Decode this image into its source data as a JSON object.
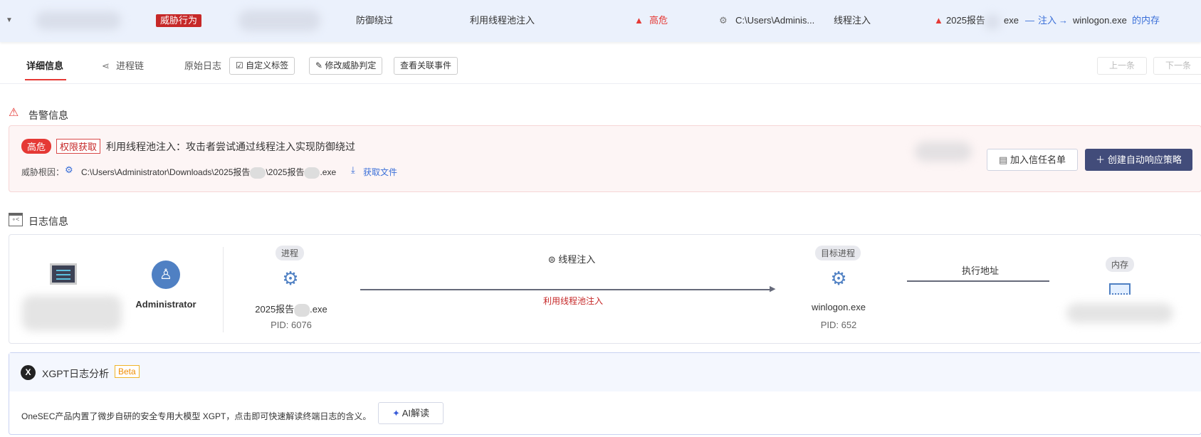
{
  "top_row": {
    "category_badge": "威胁行为",
    "tactic": "防御绕过",
    "technique": "利用线程池注入",
    "severity": "高危",
    "path": "C:\\Users\\Adminis...",
    "behavior": "线程注入",
    "chain_source": "2025报告",
    "chain_source_ext": "exe",
    "chain_action": "注入",
    "chain_target": "winlogon.exe",
    "chain_suffix": "的内存"
  },
  "tabs": {
    "detail": "详细信息",
    "process_chain": "进程链",
    "raw_log": "原始日志",
    "custom_tag": "自定义标签",
    "modify_verdict": "修改威胁判定",
    "related_events": "查看关联事件",
    "prev": "上一条",
    "next": "下一条"
  },
  "alert": {
    "title": "告警信息",
    "severity": "高危",
    "tag": "权限获取",
    "description": "利用线程池注入：攻击者尝试通过线程注入实现防御绕过",
    "root_label": "威胁根因：",
    "root_path_a": "C:\\Users\\Administrator\\Downloads\\2025报告",
    "root_path_b": "\\2025报告",
    "root_path_c": ".exe",
    "get_file": "获取文件",
    "trust_button": "加入信任名单",
    "create_policy_button": "创建自动响应策略"
  },
  "log": {
    "title": "日志信息",
    "user": "Administrator",
    "process_label": "进程",
    "process_name_a": "2025报告",
    "process_name_b": ".exe",
    "process_pid": "PID: 6076",
    "edge_label": "线程注入",
    "edge_sub": "利用线程池注入",
    "target_label": "目标进程",
    "target_name": "winlogon.exe",
    "target_pid": "PID: 652",
    "edge2_label": "执行地址",
    "memory_label": "内存"
  },
  "xgpt": {
    "title": "XGPT日志分析",
    "beta": "Beta",
    "description": "OneSEC产品内置了微步自研的安全专用大模型 XGPT，点击即可快速解读终端日志的含义。",
    "ai_button": "AI解读"
  },
  "colors": {
    "accent": "#3a6fd8",
    "danger": "#e53935",
    "primary_button": "#424c7a"
  }
}
